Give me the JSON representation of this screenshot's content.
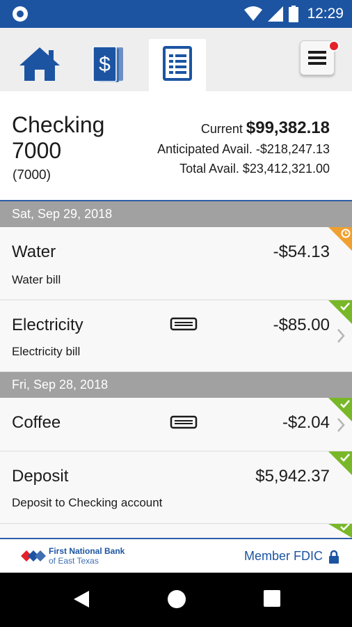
{
  "status_bar": {
    "time": "12:29"
  },
  "nav": {
    "tabs": [
      {
        "name": "home",
        "icon": "home-icon",
        "active": false
      },
      {
        "name": "transfers",
        "icon": "dollar-cards-icon",
        "active": false
      },
      {
        "name": "statements",
        "icon": "document-list-icon",
        "active": true
      }
    ],
    "menu_icon": "hamburger-menu-icon"
  },
  "account": {
    "name": "Checking 7000",
    "number": "(7000)",
    "current_label": "Current",
    "current_value": "$99,382.18",
    "anticipated_label": "Anticipated Avail.",
    "anticipated_value": "-$218,247.13",
    "total_label": "Total Avail.",
    "total_value": "$23,412,321.00"
  },
  "groups": [
    {
      "date": "Sat, Sep 29, 2018",
      "transactions": [
        {
          "title": "Water",
          "description": "Water bill",
          "amount": "-$54.13",
          "status": "pending"
        },
        {
          "title": "Electricity",
          "description": "Electricity bill",
          "amount": "-$85.00",
          "status": "cleared"
        }
      ]
    },
    {
      "date": "Fri, Sep 28, 2018",
      "transactions": [
        {
          "title": "Coffee",
          "description": "",
          "amount": "-$2.04",
          "status": "cleared"
        },
        {
          "title": "Deposit",
          "description": "Deposit to Checking account",
          "amount": "$5,942.37",
          "status": "cleared"
        }
      ]
    }
  ],
  "footer": {
    "bank_line1": "First National Bank",
    "bank_line2": "of East Texas",
    "fdic": "Member FDIC"
  },
  "colors": {
    "brand_blue": "#1c54a2",
    "cleared_green": "#78b828",
    "pending_orange": "#f0a030",
    "alert_red": "#e52129"
  }
}
